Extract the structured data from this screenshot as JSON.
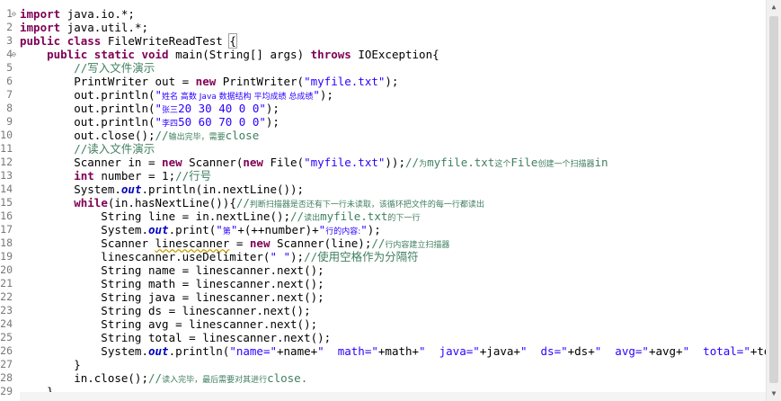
{
  "editor": {
    "lines": [
      {
        "n": "1",
        "fold": "⊖",
        "parts": [
          [
            "kw",
            "import"
          ],
          [
            "",
            "java.io.*;"
          ]
        ]
      },
      {
        "n": "2",
        "parts": [
          [
            "kw",
            "import"
          ],
          [
            "",
            "java.util.*;"
          ]
        ]
      },
      {
        "n": "3",
        "parts": [
          [
            "kw",
            "public"
          ],
          [
            "",
            ""
          ],
          [
            "kw",
            "class"
          ],
          [
            "",
            " FileWriteReadTest "
          ],
          [
            "brace",
            "{"
          ]
        ]
      },
      {
        "n": "4",
        "fold": "⊖",
        "parts": [
          [
            "",
            "    "
          ],
          [
            "kw",
            "public"
          ],
          [
            "",
            ""
          ],
          [
            "kw",
            "static"
          ],
          [
            "",
            ""
          ],
          [
            "kw",
            "void"
          ],
          [
            "",
            " main(String[] args) "
          ],
          [
            "kw",
            "throws"
          ],
          [
            "",
            " IOException{"
          ]
        ]
      },
      {
        "n": "5",
        "parts": [
          [
            "",
            "        "
          ],
          [
            "cm",
            "//写入文件演示"
          ]
        ]
      },
      {
        "n": "6",
        "parts": [
          [
            "",
            "        PrintWriter out = "
          ],
          [
            "kw",
            "new"
          ],
          [
            "",
            " PrintWriter("
          ],
          [
            "str",
            "\"myfile.txt\""
          ],
          [
            "",
            ");"
          ]
        ]
      },
      {
        "n": "7",
        "parts": [
          [
            "",
            "        out.println("
          ],
          [
            "str",
            "\""
          ],
          [
            "str sm",
            "姓名 高数 Java 数据结构 平均成绩 总成绩"
          ],
          [
            "str",
            "\""
          ],
          [
            "",
            ");"
          ]
        ]
      },
      {
        "n": "8",
        "parts": [
          [
            "",
            "        out.println("
          ],
          [
            "str",
            "\""
          ],
          [
            "str sm",
            "张三"
          ],
          [
            "str",
            "20 30 40 0 0\""
          ],
          [
            "",
            ");"
          ]
        ]
      },
      {
        "n": "9",
        "parts": [
          [
            "",
            "        out.println("
          ],
          [
            "str",
            "\""
          ],
          [
            "str sm",
            "李四"
          ],
          [
            "str",
            "50 60 70 0 0\""
          ],
          [
            "",
            ");"
          ]
        ]
      },
      {
        "n": "10",
        "parts": [
          [
            "",
            "        out.close();"
          ],
          [
            "cm",
            "//"
          ],
          [
            "cm sm",
            "输出完毕，需要"
          ],
          [
            "cm",
            "close"
          ]
        ]
      },
      {
        "n": "11",
        "parts": [
          [
            "",
            "        "
          ],
          [
            "cm",
            "//读入文件演示"
          ]
        ]
      },
      {
        "n": "12",
        "parts": [
          [
            "",
            "        Scanner in = "
          ],
          [
            "kw",
            "new"
          ],
          [
            "",
            " Scanner("
          ],
          [
            "kw",
            "new"
          ],
          [
            "",
            " File("
          ],
          [
            "str",
            "\"myfile.txt\""
          ],
          [
            "",
            "));"
          ],
          [
            "cm",
            "//"
          ],
          [
            "cm sm",
            "为"
          ],
          [
            "cm",
            "myfile.txt"
          ],
          [
            "cm sm",
            "这个"
          ],
          [
            "cm",
            "File"
          ],
          [
            "cm sm",
            "创建一个扫描器"
          ],
          [
            "cm",
            "in"
          ]
        ]
      },
      {
        "n": "13",
        "parts": [
          [
            "",
            "        "
          ],
          [
            "kw",
            "int"
          ],
          [
            "",
            " number = 1;"
          ],
          [
            "cm",
            "//行号"
          ]
        ]
      },
      {
        "n": "14",
        "parts": [
          [
            "",
            "        System."
          ],
          [
            "fld",
            "out"
          ],
          [
            "",
            ".println(in.nextLine());"
          ]
        ]
      },
      {
        "n": "15",
        "parts": [
          [
            "",
            "        "
          ],
          [
            "kw",
            "while"
          ],
          [
            "",
            "(in.hasNextLine()){"
          ],
          [
            "cm",
            "//"
          ],
          [
            "cm sm",
            "判断扫描器是否还有下一行未读取，该循环把文件的每一行都读出"
          ]
        ]
      },
      {
        "n": "16",
        "parts": [
          [
            "",
            "            String line = in.nextLine();"
          ],
          [
            "cm",
            "//"
          ],
          [
            "cm sm",
            "读出"
          ],
          [
            "cm",
            "myfile.txt"
          ],
          [
            "cm sm",
            "的下一行"
          ]
        ]
      },
      {
        "n": "17",
        "parts": [
          [
            "",
            "            System."
          ],
          [
            "fld",
            "out"
          ],
          [
            "",
            ".print("
          ],
          [
            "str",
            "\""
          ],
          [
            "str sm",
            "第"
          ],
          [
            "str",
            "\""
          ],
          [
            "",
            "+(++number)+"
          ],
          [
            "str",
            "\""
          ],
          [
            "str sm",
            "行的内容:"
          ],
          [
            "str",
            "\""
          ],
          [
            "",
            ");"
          ]
        ]
      },
      {
        "n": "18",
        "parts": [
          [
            "",
            "            Scanner "
          ],
          [
            "warn",
            "linescanner"
          ],
          [
            "",
            " = "
          ],
          [
            "kw",
            "new"
          ],
          [
            "",
            " Scanner(line);"
          ],
          [
            "cm",
            "//"
          ],
          [
            "cm sm",
            "行内容建立扫描器"
          ]
        ]
      },
      {
        "n": "19",
        "parts": [
          [
            "",
            "            linescanner.useDelimiter("
          ],
          [
            "str",
            "\" \""
          ],
          [
            "",
            ");"
          ],
          [
            "cm",
            "//使用空格作为分隔符"
          ]
        ]
      },
      {
        "n": "20",
        "parts": [
          [
            "",
            "            String name = linescanner.next();"
          ]
        ]
      },
      {
        "n": "21",
        "parts": [
          [
            "",
            "            String math = linescanner.next();"
          ]
        ]
      },
      {
        "n": "22",
        "parts": [
          [
            "",
            "            String java = linescanner.next();"
          ]
        ]
      },
      {
        "n": "23",
        "parts": [
          [
            "",
            "            String ds = linescanner.next();"
          ]
        ]
      },
      {
        "n": "24",
        "parts": [
          [
            "",
            "            String avg = linescanner.next();"
          ]
        ]
      },
      {
        "n": "25",
        "parts": [
          [
            "",
            "            String total = linescanner.next();"
          ]
        ]
      },
      {
        "n": "26",
        "parts": [
          [
            "",
            "            System."
          ],
          [
            "fld",
            "out"
          ],
          [
            "",
            ".println("
          ],
          [
            "str",
            "\"name=\""
          ],
          [
            "",
            "+name+"
          ],
          [
            "str",
            "\"  math=\""
          ],
          [
            "",
            "+math+"
          ],
          [
            "str",
            "\"  java=\""
          ],
          [
            "",
            "+java+"
          ],
          [
            "str",
            "\"  ds=\""
          ],
          [
            "",
            "+ds+"
          ],
          [
            "str",
            "\"  avg=\""
          ],
          [
            "",
            "+avg+"
          ],
          [
            "str",
            "\"  total=\""
          ],
          [
            "",
            "+total);"
          ]
        ]
      },
      {
        "n": "27",
        "parts": [
          [
            "",
            "        }"
          ]
        ]
      },
      {
        "n": "28",
        "parts": [
          [
            "",
            "        in.close();"
          ],
          [
            "cm",
            "//"
          ],
          [
            "cm sm",
            "读入完毕，最后需要对其进行"
          ],
          [
            "cm",
            "close."
          ]
        ]
      },
      {
        "n": "29",
        "parts": [
          [
            "",
            "    }"
          ]
        ]
      }
    ]
  },
  "scrollbar": {
    "up_icon": "▲",
    "down_icon": "▼"
  },
  "colors": {
    "keyword": "#7f0055",
    "string": "#2a00ff",
    "comment": "#3f7f5f",
    "field": "#0000c0"
  }
}
